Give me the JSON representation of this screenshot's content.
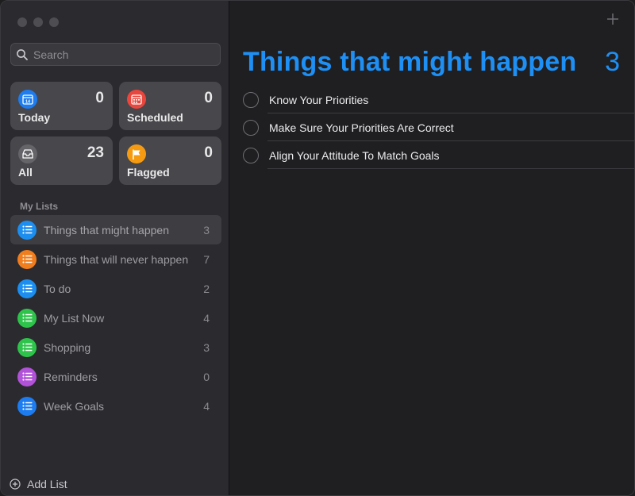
{
  "window": {
    "traffic_lights": [
      "close",
      "minimize",
      "zoom"
    ]
  },
  "search": {
    "placeholder": "Search"
  },
  "smart_lists": [
    {
      "label": "Today",
      "count": "0",
      "color": "#1c7cf0",
      "icon": "calendar-today-icon",
      "glyph": "14"
    },
    {
      "label": "Scheduled",
      "count": "0",
      "color": "#e9463d",
      "icon": "calendar-scheduled-icon"
    },
    {
      "label": "All",
      "count": "23",
      "color": "#646469",
      "icon": "tray-icon"
    },
    {
      "label": "Flagged",
      "count": "0",
      "color": "#f59b12",
      "icon": "flag-icon"
    }
  ],
  "my_lists_heading": "My Lists",
  "lists": [
    {
      "name": "Things that might happen",
      "count": "3",
      "color": "#1c8ef0",
      "selected": true
    },
    {
      "name": "Things that will never happen",
      "count": "7",
      "color": "#f07d1e"
    },
    {
      "name": "To do",
      "count": "2",
      "color": "#1c8ef0"
    },
    {
      "name": "My List Now",
      "count": "4",
      "color": "#2ec44b"
    },
    {
      "name": "Shopping",
      "count": "3",
      "color": "#2ec44b"
    },
    {
      "name": "Reminders",
      "count": "0",
      "color": "#b152d8"
    },
    {
      "name": "Week Goals",
      "count": "4",
      "color": "#1c7cf0"
    }
  ],
  "add_list_label": "Add List",
  "main": {
    "title": "Things that might happen",
    "count": "3",
    "accent": "#1e90f5",
    "tasks": [
      "Know Your Priorities",
      "Make Sure Your Priorities Are Correct",
      "Align Your Attitude To Match Goals"
    ]
  }
}
